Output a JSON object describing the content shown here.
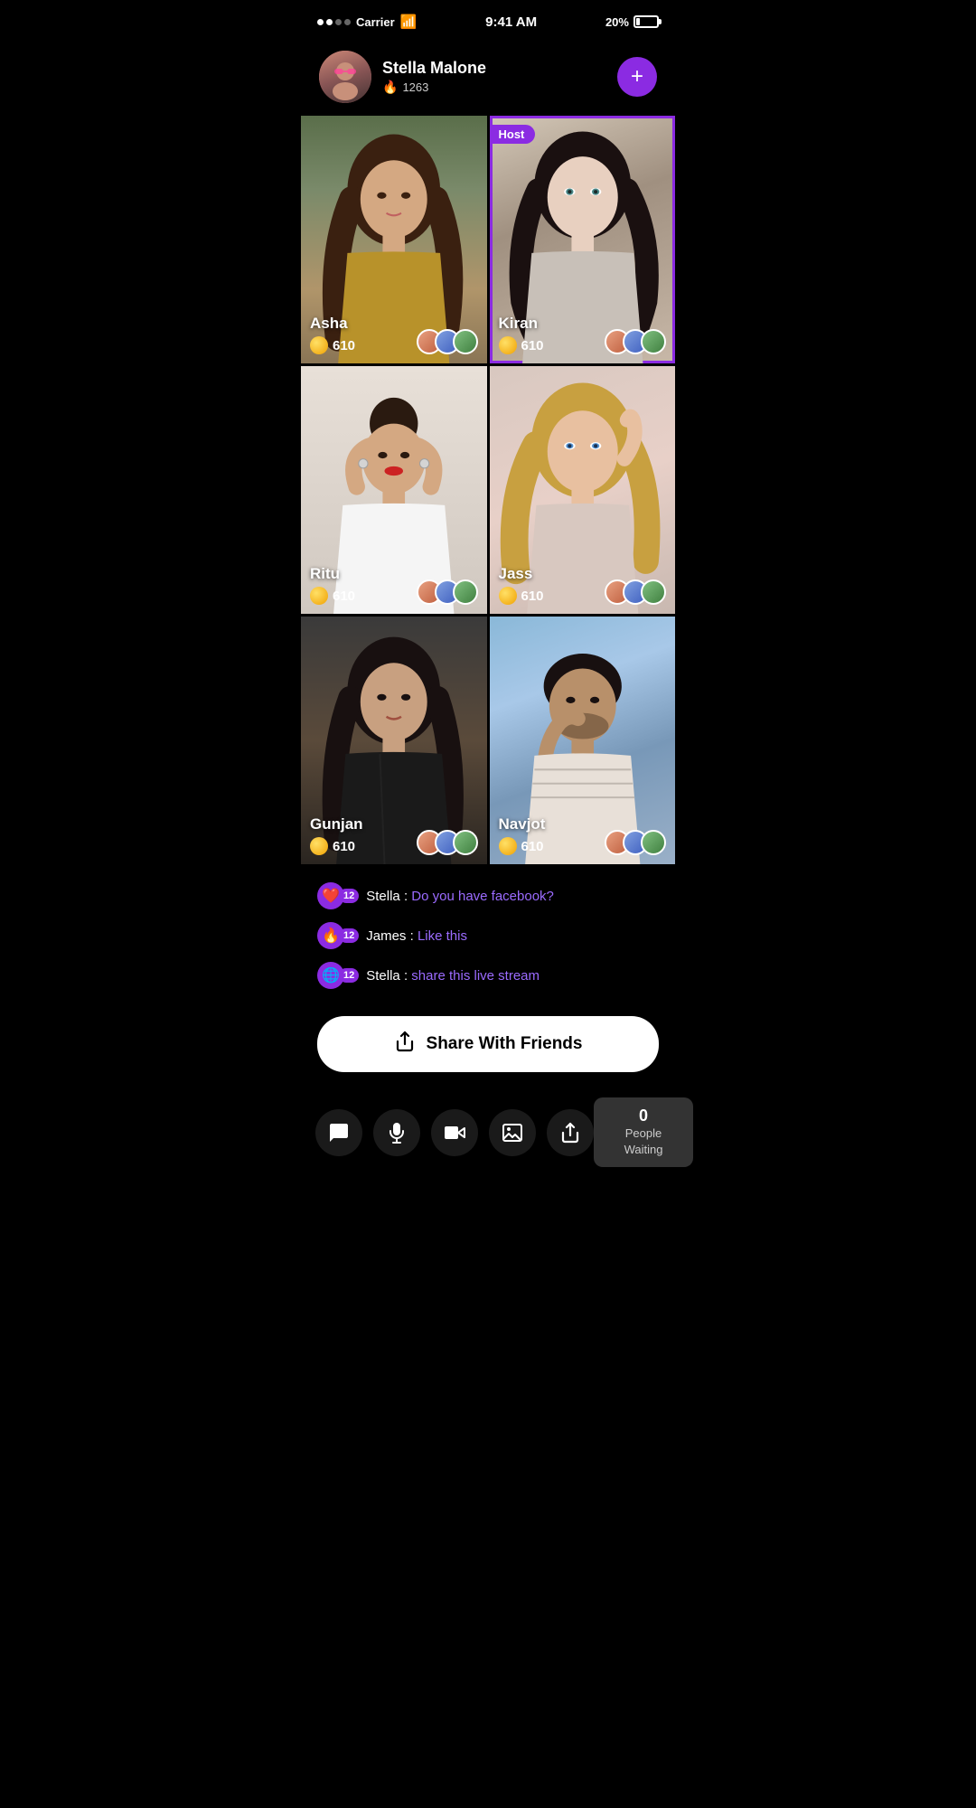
{
  "status": {
    "carrier": "Carrier",
    "time": "9:41 AM",
    "battery": "20%"
  },
  "profile": {
    "name": "Stella Malone",
    "score": "1263",
    "add_label": "+"
  },
  "grid": [
    {
      "id": "asha",
      "name": "Asha",
      "score": "610",
      "is_host": false,
      "bg_class": "bg-asha"
    },
    {
      "id": "kiran",
      "name": "Kiran",
      "score": "610",
      "is_host": true,
      "bg_class": "bg-kiran"
    },
    {
      "id": "ritu",
      "name": "Ritu",
      "score": "610",
      "is_host": false,
      "bg_class": "bg-ritu"
    },
    {
      "id": "jass",
      "name": "Jass",
      "score": "610",
      "is_host": false,
      "bg_class": "bg-jass"
    },
    {
      "id": "gunjan",
      "name": "Gunjan",
      "score": "610",
      "is_host": false,
      "bg_class": "bg-gunjan"
    },
    {
      "id": "navjot",
      "name": "Navjot",
      "score": "610",
      "is_host": false,
      "bg_class": "bg-navjot"
    }
  ],
  "host_badge": "Host",
  "messages": [
    {
      "id": "msg1",
      "icon": "❤️",
      "badge": "12",
      "user": "Stella",
      "text": "Do you have facebook?"
    },
    {
      "id": "msg2",
      "icon": "🔥",
      "badge": "12",
      "user": "James",
      "text": "Like this"
    },
    {
      "id": "msg3",
      "icon": "🌐",
      "badge": "12",
      "user": "Stella",
      "text": "share this live stream"
    }
  ],
  "share": {
    "label": "Share With Friends"
  },
  "bottom_bar": {
    "people_count": "0",
    "people_label": "People Waiting"
  }
}
